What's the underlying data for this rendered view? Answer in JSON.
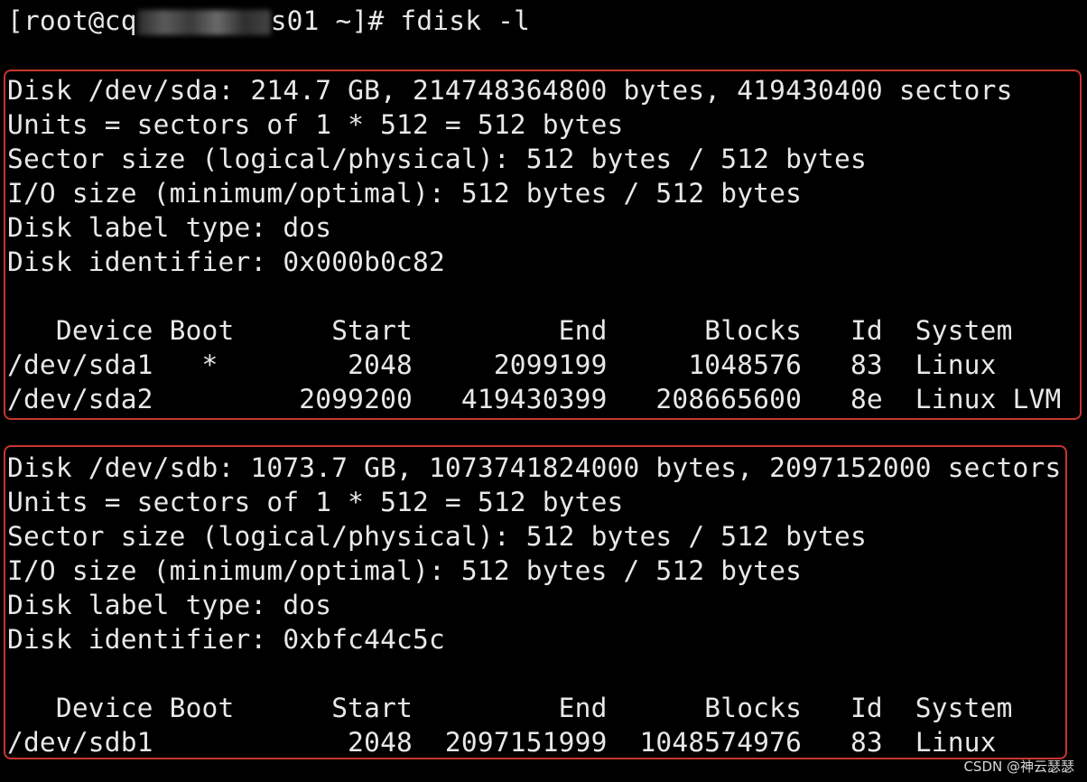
{
  "colors": {
    "background": "#000000",
    "text": "#e8e8e8",
    "highlight_box": "#c8352e"
  },
  "prompt": {
    "user_host_prefix": "[root@cq",
    "user_host_suffix": "s01 ~]# ",
    "command": "fdisk -l"
  },
  "disks": [
    {
      "info_lines": [
        "Disk /dev/sda: 214.7 GB, 214748364800 bytes, 419430400 sectors",
        "Units = sectors of 1 * 512 = 512 bytes",
        "Sector size (logical/physical): 512 bytes / 512 bytes",
        "I/O size (minimum/optimal): 512 bytes / 512 bytes",
        "Disk label type: dos",
        "Disk identifier: 0x000b0c82"
      ],
      "table_header": "   Device Boot      Start         End      Blocks   Id  System",
      "partitions": [
        "/dev/sda1   *        2048     2099199     1048576   83  Linux",
        "/dev/sda2         2099200   419430399   208665600   8e  Linux LVM"
      ]
    },
    {
      "info_lines": [
        "Disk /dev/sdb: 1073.7 GB, 1073741824000 bytes, 2097152000 sectors",
        "Units = sectors of 1 * 512 = 512 bytes",
        "Sector size (logical/physical): 512 bytes / 512 bytes",
        "I/O size (minimum/optimal): 512 bytes / 512 bytes",
        "Disk label type: dos",
        "Disk identifier: 0xbfc44c5c"
      ],
      "table_header": "   Device Boot      Start         End      Blocks   Id  System",
      "partitions": [
        "/dev/sdb1            2048  2097151999  1048574976   83  Linux"
      ]
    }
  ],
  "watermark": "CSDN @神云瑟瑟"
}
